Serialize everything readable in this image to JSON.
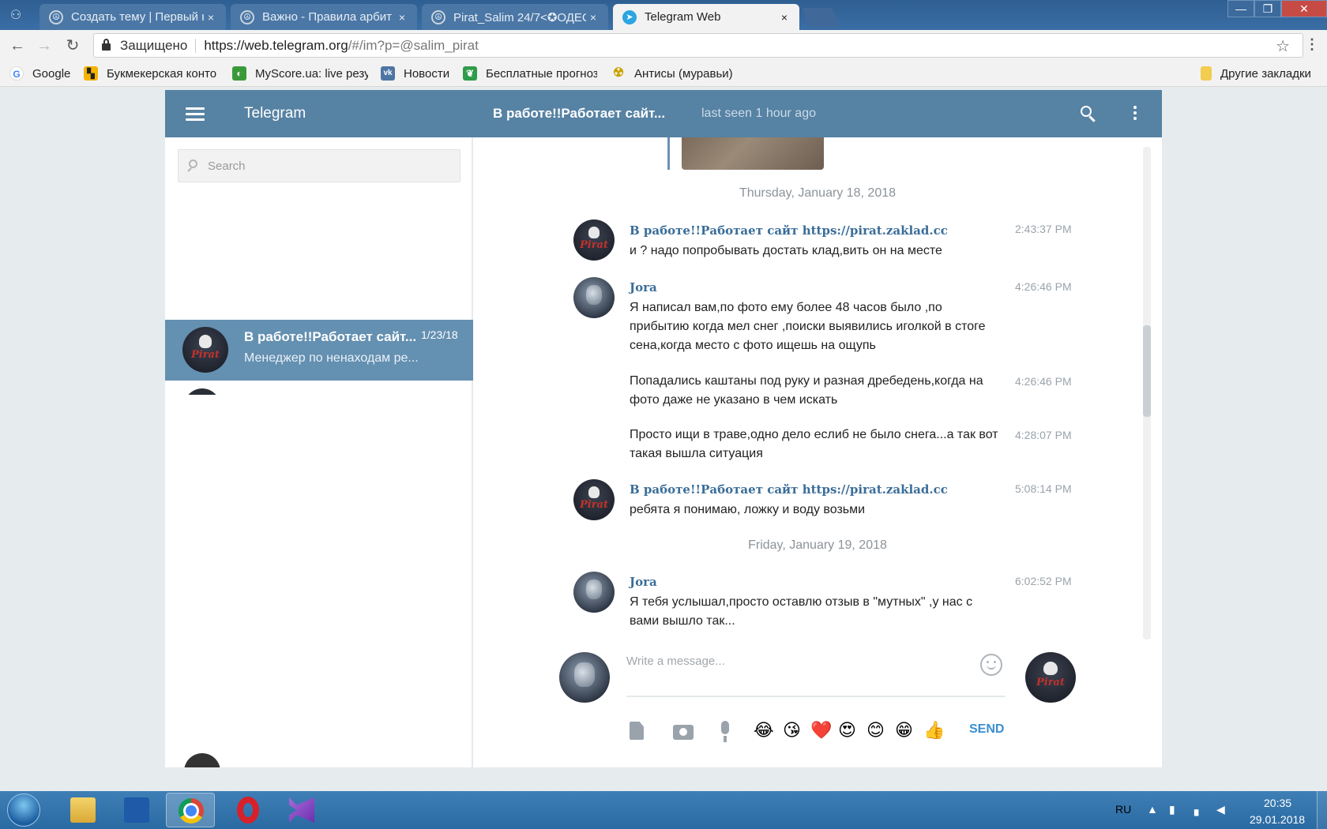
{
  "browser": {
    "tabs": [
      {
        "label": "Создать тему | Первый н",
        "close": "×"
      },
      {
        "label": "Важно - Правила арбит",
        "close": "×"
      },
      {
        "label": "Pirat_Salim 24/7<✪ОДЕС",
        "close": "×"
      },
      {
        "label": "Telegram Web",
        "close": "×"
      }
    ],
    "window_buttons": {
      "minimize": "—",
      "maximize": "❐",
      "close": "✕"
    },
    "address": {
      "secure_label": "Защищено",
      "url_host": "https://web.telegram.org",
      "url_path": "/#/im?p=@salim_pirat"
    },
    "bookmarks": [
      {
        "label": "Google",
        "icon": "google-icon",
        "color": "#4285f4",
        "glyph": "G"
      },
      {
        "label": "Букмекерская конто",
        "icon": "bookmaker-icon",
        "color": "#f5b400",
        "glyph": "▚"
      },
      {
        "label": "MyScore.ua: live резу",
        "icon": "myscore-icon",
        "color": "#3a9a3a",
        "glyph": "◐"
      },
      {
        "label": "Новости",
        "icon": "vk-icon",
        "color": "#4c75a3",
        "glyph": "vk"
      },
      {
        "label": "Бесплатные прогноз",
        "icon": "leaf-icon",
        "color": "#2e9c4a",
        "glyph": "❦"
      },
      {
        "label": "Антисы (муравьи)",
        "icon": "radiation-icon",
        "color": "#c9a400",
        "glyph": "☢"
      }
    ],
    "other_bookmarks": "Другие закладки"
  },
  "telegram": {
    "brand": "Telegram",
    "peer_name": "В работе!!Работает сайт...",
    "peer_status": "last seen 1 hour ago",
    "search_placeholder": "Search",
    "dialog": {
      "name": "В работе!!Работает сайт...",
      "date": "1/23/18",
      "preview": "Менеджер по ненаходам ре..."
    },
    "dates": [
      "Thursday, January 18, 2018",
      "Friday, January 19, 2018"
    ],
    "messages": [
      {
        "author": "В работе!!Работает сайт https://pirat.zaklad.cc",
        "text": "и ? надо попробывать достать клад,вить он на месте",
        "time": "2:43:37 PM"
      },
      {
        "author": "Jora",
        "text": "Я написал вам,по фото ему более 48 часов было ,по прибытию когда мел снег ,поиски выявились иголкой в стоге сена,когда место с фото ищешь на ощупь",
        "time": "4:26:46 PM"
      },
      {
        "author": "",
        "text": "Попадались каштаны под руку и разная дребедень,когда на фото даже не указано в чем искать",
        "time": "4:26:46 PM"
      },
      {
        "author": "",
        "text": "Просто ищи в траве,одно дело еслиб не было снега...а так вот такая вышла ситуация",
        "time": "4:28:07 PM"
      },
      {
        "author": "В работе!!Работает сайт https://pirat.zaklad.cc",
        "text": "ребята  я понимаю, ложку и воду возьми",
        "time": "5:08:14 PM"
      },
      {
        "author": "Jora",
        "text": "Я тебя услышал,просто оставлю отзыв в \"мутных\" ,у нас с вами вышло так...",
        "time": "6:02:52 PM"
      }
    ],
    "composer": {
      "placeholder": "Write a message...",
      "send_label": "SEND",
      "quick_emoji": [
        "😂",
        "😘",
        "❤️",
        "😍",
        "😊",
        "😁",
        "👍"
      ]
    }
  },
  "taskbar": {
    "lang": "RU",
    "time": "20:35",
    "date": "29.01.2018"
  }
}
